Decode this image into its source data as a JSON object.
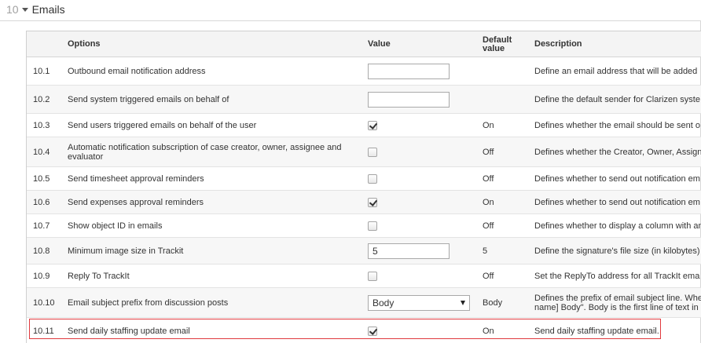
{
  "section": {
    "number": "10",
    "title": "Emails"
  },
  "columns": {
    "options": "Options",
    "value": "Value",
    "default_line1": "Default",
    "default_line2": "value",
    "description": "Description"
  },
  "rows": [
    {
      "num": "10.1",
      "option": "Outbound email notification address",
      "control": "text",
      "value": "",
      "default": "",
      "description": "Define an email address that will be added"
    },
    {
      "num": "10.2",
      "option": "Send system triggered emails on behalf of",
      "control": "text",
      "value": "",
      "default": "",
      "description": "Define the default sender for Clarizen syste"
    },
    {
      "num": "10.3",
      "option": "Send users triggered emails on behalf of the user",
      "control": "checkbox",
      "checked": true,
      "default": "On",
      "description": "Defines whether the email should be sent o"
    },
    {
      "num": "10.4",
      "option": "Automatic notification subscription of case creator, owner, assignee and evaluator",
      "control": "checkbox",
      "checked": false,
      "default": "Off",
      "description": "Defines whether the Creator, Owner, Assign"
    },
    {
      "num": "10.5",
      "option": "Send timesheet approval reminders",
      "control": "checkbox",
      "checked": false,
      "default": "Off",
      "description": "Defines whether to send out notification em"
    },
    {
      "num": "10.6",
      "option": "Send expenses approval reminders",
      "control": "checkbox",
      "checked": true,
      "default": "On",
      "description": "Defines whether to send out notification em"
    },
    {
      "num": "10.7",
      "option": "Show object ID in emails",
      "control": "checkbox",
      "checked": false,
      "default": "Off",
      "description": "Defines whether to display a column with an"
    },
    {
      "num": "10.8",
      "option": "Minimum image size in Trackit",
      "control": "text",
      "value": "5",
      "default": "5",
      "description": "Define the signature's file size (in kilobytes)"
    },
    {
      "num": "10.9",
      "option": "Reply To TrackIt",
      "control": "checkbox",
      "checked": false,
      "default": "Off",
      "description": "Set the ReplyTo address for all TrackIt ema"
    },
    {
      "num": "10.10",
      "option": "Email subject prefix from discussion posts",
      "control": "select",
      "value": "Body",
      "default": "Body",
      "description": "Defines the prefix of email subject line. Whe name] Body\". Body is the first line of text in"
    },
    {
      "num": "10.11",
      "option": "Send daily staffing update email",
      "control": "checkbox",
      "checked": true,
      "default": "On",
      "description": "Send daily staffing update email."
    }
  ]
}
